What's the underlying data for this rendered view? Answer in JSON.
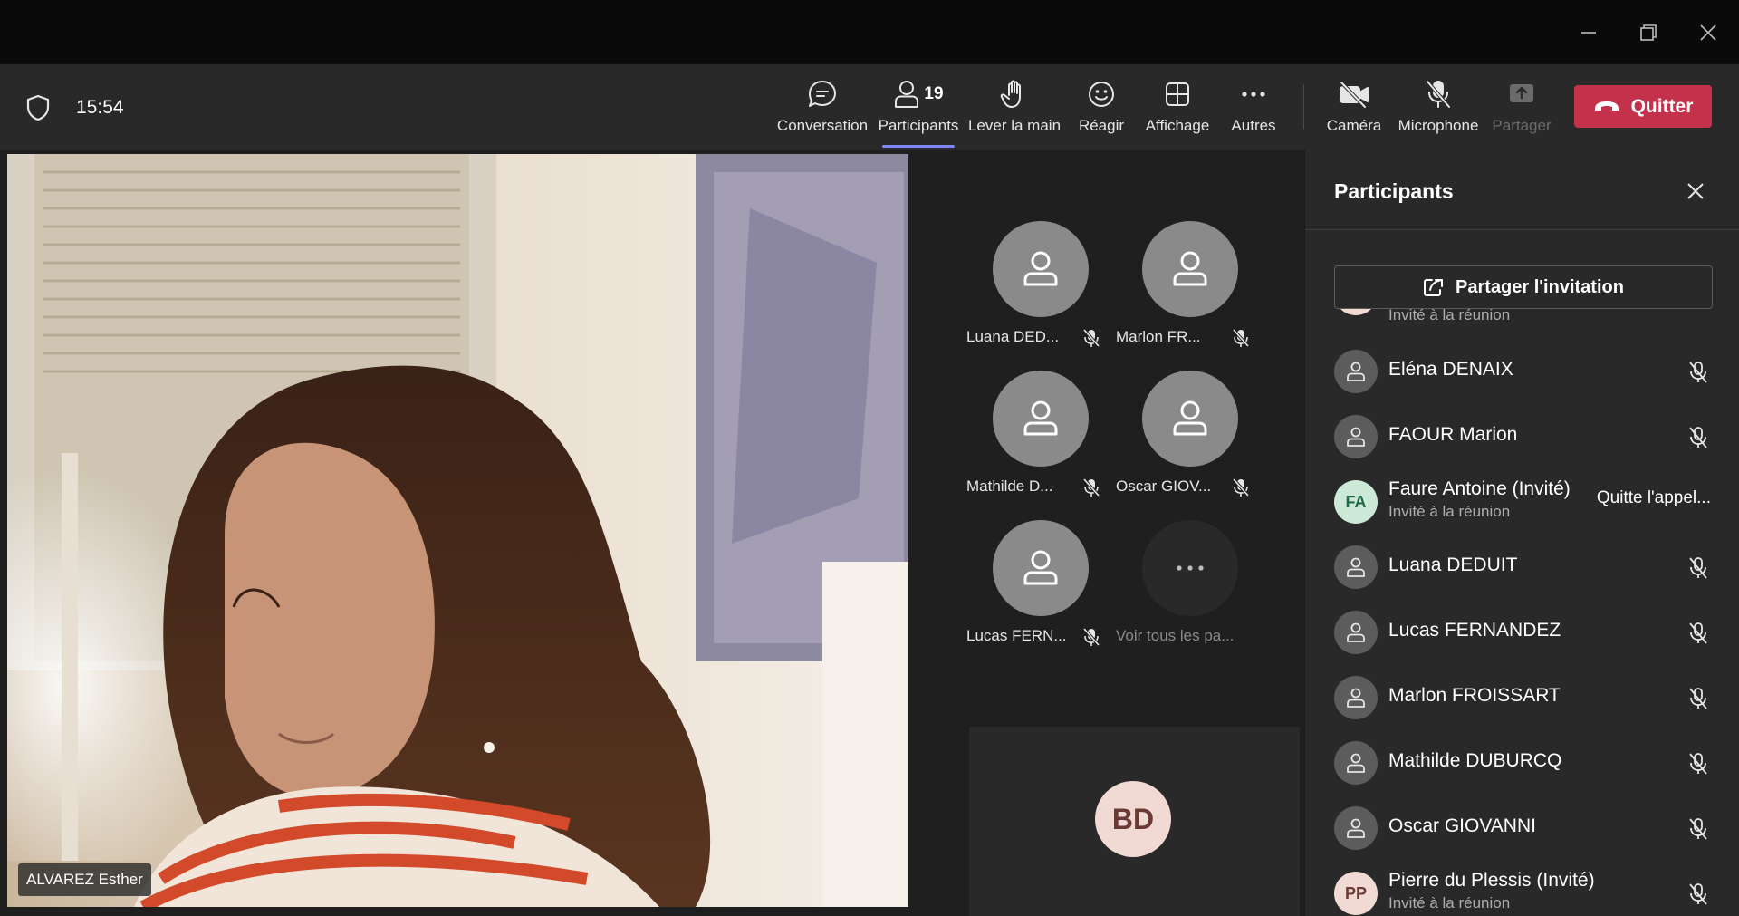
{
  "toolbar": {
    "time": "15:54",
    "buttons": {
      "chat": "Conversation",
      "participants": "Participants",
      "participants_count": "19",
      "raise_hand": "Lever la main",
      "react": "Réagir",
      "view": "Affichage",
      "more": "Autres",
      "camera": "Caméra",
      "mic": "Microphone",
      "share": "Partager",
      "leave": "Quitter"
    }
  },
  "main_video": {
    "name": "ALVAREZ Esther"
  },
  "gallery": {
    "tiles": [
      {
        "name": "Luana DED..."
      },
      {
        "name": "Marlon FR..."
      },
      {
        "name": "Mathilde D..."
      },
      {
        "name": "Oscar GIOV..."
      },
      {
        "name": "Lucas FERN..."
      },
      {
        "name": "Voir tous les pa..."
      }
    ],
    "self_initials": "BD"
  },
  "panel": {
    "title": "Participants",
    "share_invite": "Partager l'invitation",
    "partial_row_sub": "Invité à la réunion",
    "participants": [
      {
        "name": "Eléna DENAIX"
      },
      {
        "name": "FAOUR Marion"
      },
      {
        "name": "Faure Antoine (Invité)",
        "initials": "FA",
        "sub": "Invité à la réunion",
        "status": "Quitte l'appel..."
      },
      {
        "name": "Luana DEDUIT"
      },
      {
        "name": "Lucas FERNANDEZ"
      },
      {
        "name": "Marlon FROISSART"
      },
      {
        "name": "Mathilde DUBURCQ"
      },
      {
        "name": "Oscar GIOVANNI"
      },
      {
        "name": "Pierre du Plessis (Invité)",
        "initials": "PP",
        "sub": "Invité à la réunion"
      }
    ]
  },
  "colors": {
    "accent": "#7f85f5",
    "leave": "#c4314b",
    "toolbar_bg": "#292929",
    "titlebar_bg": "#0a0a0a"
  }
}
